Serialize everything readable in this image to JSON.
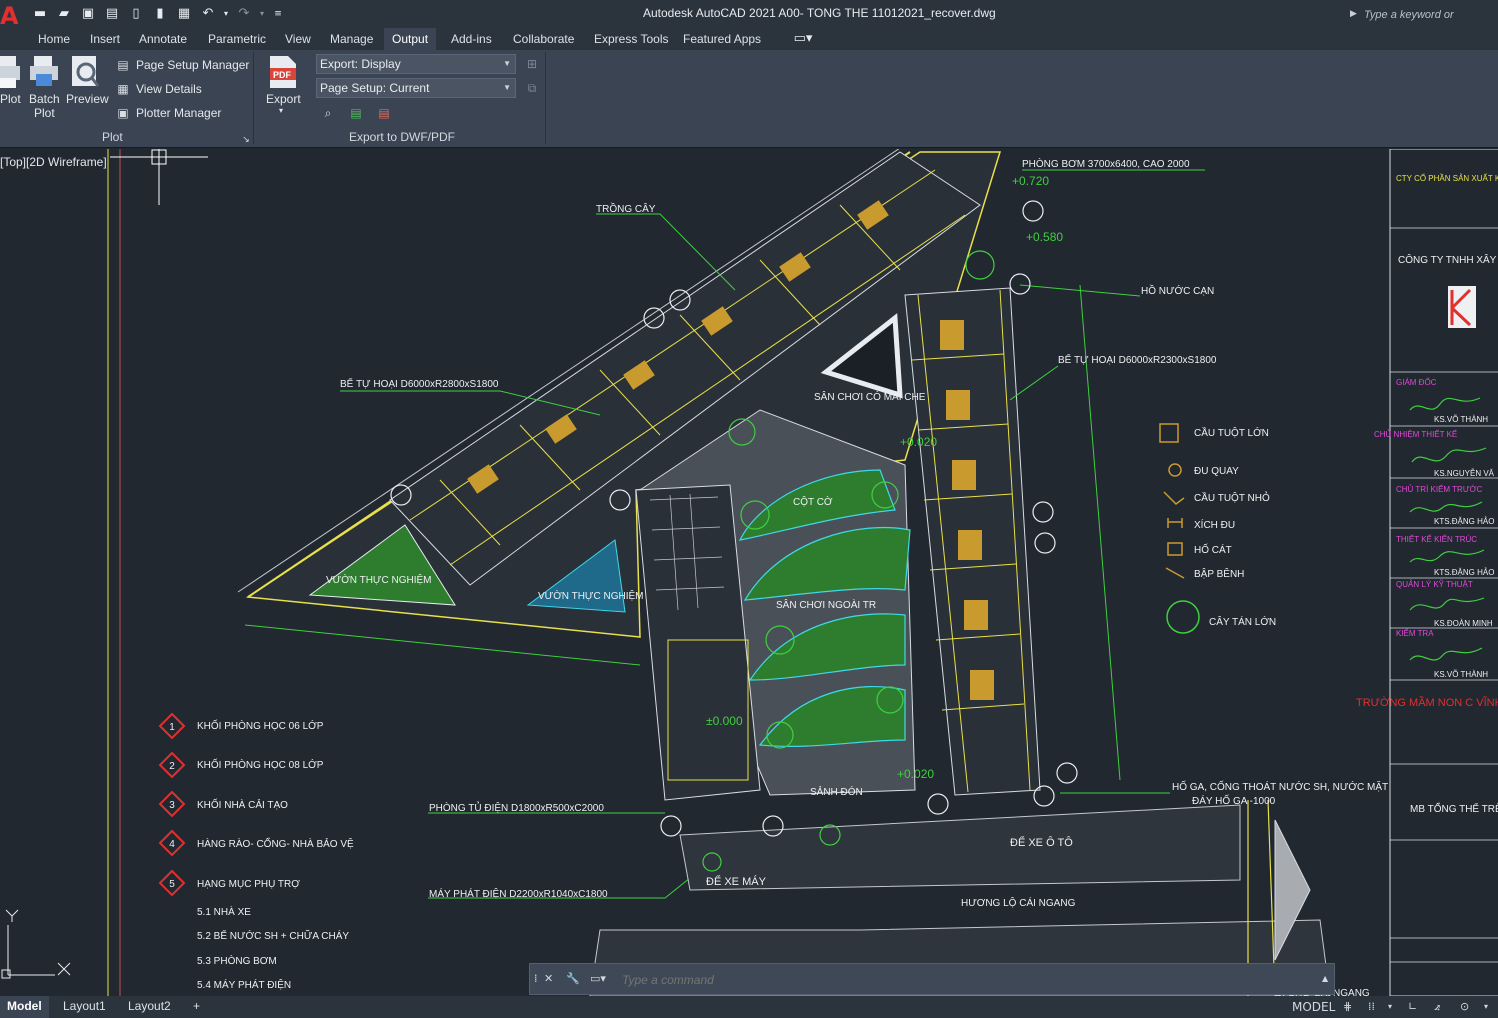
{
  "title_bar": {
    "app_and_file": "Autodesk AutoCAD 2021    A00- TONG THE 11012021_recover.dwg",
    "search_placeholder": "Type a keyword or phrase"
  },
  "ribbon_tabs": [
    {
      "label": "Home"
    },
    {
      "label": "Insert"
    },
    {
      "label": "Annotate"
    },
    {
      "label": "Parametric"
    },
    {
      "label": "View"
    },
    {
      "label": "Manage"
    },
    {
      "label": "Output",
      "active": true
    },
    {
      "label": "Add-ins"
    },
    {
      "label": "Collaborate"
    },
    {
      "label": "Express Tools"
    },
    {
      "label": "Featured Apps"
    }
  ],
  "ribbon": {
    "plot_panel": {
      "plot_label": "Plot",
      "batch_plot_label": "Batch\nPlot",
      "preview_label": "Preview",
      "page_setup_manager": "Page Setup Manager",
      "view_details": "View Details",
      "plotter_manager": "Plotter Manager",
      "panel_title": "Plot"
    },
    "export_panel": {
      "export_label": "Export",
      "export_dropdown": "Export: Display",
      "page_setup_dropdown": "Page Setup: Current",
      "panel_title": "Export to DWF/PDF"
    }
  },
  "viewport": {
    "label": "[Top][2D Wireframe]"
  },
  "drawing": {
    "annotations": {
      "phong_bom": "PHÒNG BƠM 3700x6400, CAO 2000",
      "level_0720": "+0.720",
      "level_0580": "+0.580",
      "trong_cay": "TRỒNG CÂY",
      "ho_nuoc_can": "HỒ NƯỚC CẠN",
      "be_tu_hoai_right": "BỂ TỰ HOẠI D6000xR2300xS1800",
      "be_tu_hoai_left": "BỂ TỰ HOẠI D6000xR2800xS1800",
      "san_choi_cu": "SÂN CHƠI CÓ MÁI CHE",
      "cot_co": "CỘT CỜ",
      "vuon_thuc_nghiem_1": "VƯỜN THỰC NGHIỆM",
      "vuon_thuc_nghiem_2": "VƯỜN THỰC NGHIỆM",
      "san_choi_ngoai_troi": "SÂN CHƠI NGOÀI TR",
      "sanh_don": "SẢNH ĐÓN",
      "phong_tu_dien": "PHÒNG TỦ ĐIỆN D1800xR500xC2000",
      "may_phat_dien": "MÁY PHÁT ĐIỆN D2200xR1040xC1800",
      "de_xe_may": "ĐỂ XE MÁY",
      "de_xe_oto": "ĐỂ XE Ô TÔ",
      "huong_lo": "HƯƠNG LỘ CÁI NGANG",
      "ho_ga": "HỐ GA, CỐNG THOÁT NƯỚC SH, NƯỚC MẶT",
      "day_ho_ga": "ĐÁY HỐ GA -1000",
      "di_cho": "ĐI CHỢ CÁI NGANG",
      "level_0020_a": "+0.020",
      "level_0020_b": "+0.020",
      "level_0000": "±0.000"
    },
    "equipment_legend": [
      {
        "label": "CẦU TUỘT LỚN"
      },
      {
        "label": "ĐU QUAY"
      },
      {
        "label": "CẦU TUỘT NHỎ"
      },
      {
        "label": "XÍCH ĐU"
      },
      {
        "label": "HỐ CÁT"
      },
      {
        "label": "BẬP BÊNH"
      },
      {
        "label": "CÂY TÁN LỚN"
      }
    ],
    "block_legend": [
      {
        "num": "1",
        "label": "KHỐI PHÒNG HỌC 06 LỚP"
      },
      {
        "num": "2",
        "label": "KHỐI PHÒNG HỌC 08 LỚP"
      },
      {
        "num": "3",
        "label": "KHỐI NHÀ CẢI TẠO"
      },
      {
        "num": "4",
        "label": "HÀNG RÀO- CỔNG- NHÀ BẢO VỆ"
      },
      {
        "num": "5",
        "label": "HẠNG MỤC PHỤ TRỢ"
      }
    ],
    "sub_items": [
      "5.1 NHÀ XE",
      "5.2 BỂ NƯỚC SH + CHỮA CHÁY",
      "5.3 PHÒNG BƠM",
      "5.4 MÁY PHÁT ĐIỆN"
    ]
  },
  "title_block": {
    "company_owner": "CTY CỔ PHẦN SẢN XUẤT KINH DOANH XUẤT NHẬP KHẨU LONG",
    "designer_company": "CÔNG TY TNHH XÂY HATECCO",
    "project": "TRƯỜNG MẦM NON C VĨNH LONG",
    "drawing_name": "MB TỔNG THỂ TRỆ",
    "rows": [
      "GIÁM ĐỐC",
      "KS.VÕ THÀNH",
      "CHỦ NHIỆM THIẾT KẾ",
      "KS.NGUYỄN VĂ",
      "CHỦ TRÌ KIỂM TRƯỚC",
      "KTS.ĐẶNG HẢO",
      "THIẾT KẾ KIẾN TRÚC",
      "KTS.ĐẶNG HẢO",
      "QUẢN LÝ KỸ THUẬT",
      "KS.ĐOÀN MINH",
      "KIỂM TRA",
      "KS.VÕ THÀNH"
    ]
  },
  "command_line": {
    "placeholder": "Type a command"
  },
  "status_bar": {
    "tabs": [
      {
        "label": "Model",
        "active": true
      },
      {
        "label": "Layout1"
      },
      {
        "label": "Layout2"
      }
    ],
    "model_label": "MODEL"
  },
  "colors": {
    "accent_red": "#e0302f",
    "cad_bg": "#212830",
    "ribbon_bg": "#3b4452",
    "line_yellow": "#e8e04a",
    "line_green": "#3fcf3f",
    "line_magenta": "#e04ad8",
    "line_cyan": "#3fd8e8"
  }
}
